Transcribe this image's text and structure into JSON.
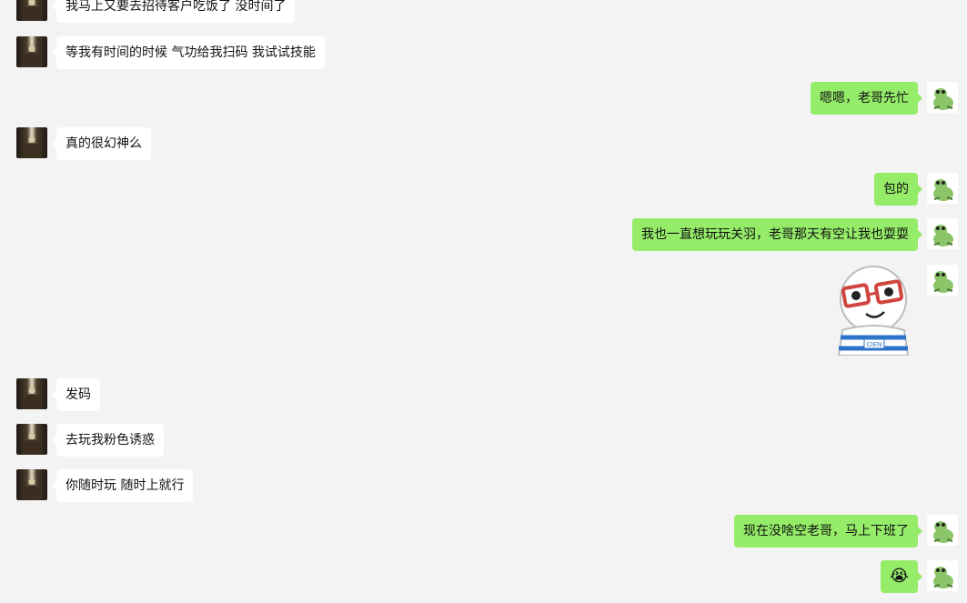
{
  "messages": [
    {
      "side": "left",
      "text": "我马上又要去招待客户吃饭了  没时间了"
    },
    {
      "side": "left",
      "text": "等我有时间的时候 气功给我扫码 我试试技能"
    },
    {
      "side": "right",
      "text": "嗯嗯，老哥先忙"
    },
    {
      "side": "left",
      "text": "真的很幻神么"
    },
    {
      "side": "right",
      "text": "包的"
    },
    {
      "side": "right",
      "text": "我也一直想玩玩关羽，老哥那天有空让我也耍耍"
    },
    {
      "side": "right",
      "type": "sticker",
      "sticker_label": "CIEN"
    },
    {
      "side": "left",
      "text": "发码"
    },
    {
      "side": "left",
      "text": "去玩我粉色诱惑"
    },
    {
      "side": "left",
      "text": "你随时玩 随时上就行"
    },
    {
      "side": "right",
      "text": "现在没啥空老哥，马上下班了"
    },
    {
      "side": "right",
      "text": "😭"
    }
  ],
  "avatars": {
    "contact": "man-photo",
    "self": "frog-cartoon"
  },
  "colors": {
    "background": "#f3f3f3",
    "incoming_bubble": "#ffffff",
    "outgoing_bubble": "#95ec69"
  }
}
